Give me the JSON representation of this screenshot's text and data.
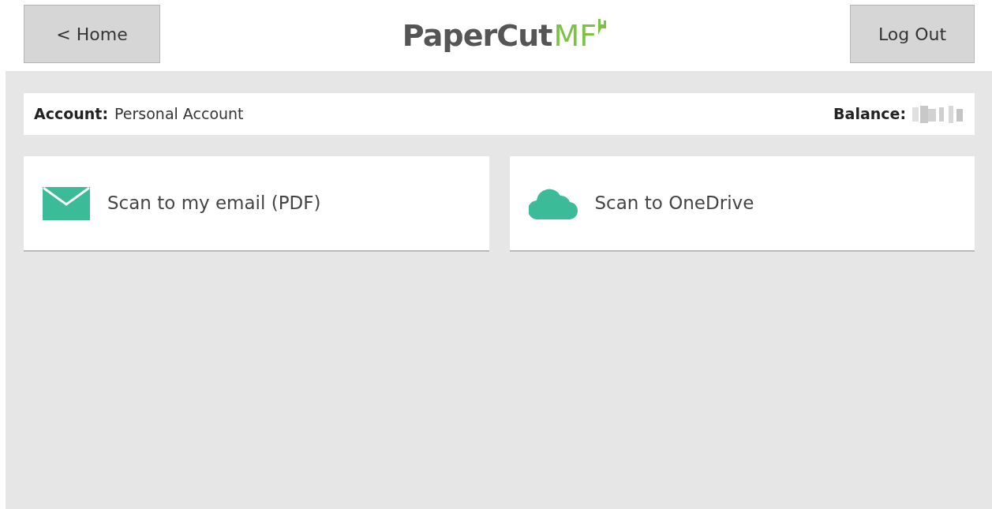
{
  "header": {
    "home_button": "< Home",
    "logo": {
      "name": "PaperCut",
      "suffix": "MF"
    },
    "logout_button": "Log Out"
  },
  "account_bar": {
    "account_label": "Account:",
    "account_value": "Personal Account",
    "balance_label": "Balance:",
    "balance_redacted": true
  },
  "actions": [
    {
      "kind": "email",
      "label": "Scan to my email (PDF)"
    },
    {
      "kind": "cloud",
      "label": "Scan to OneDrive"
    }
  ]
}
